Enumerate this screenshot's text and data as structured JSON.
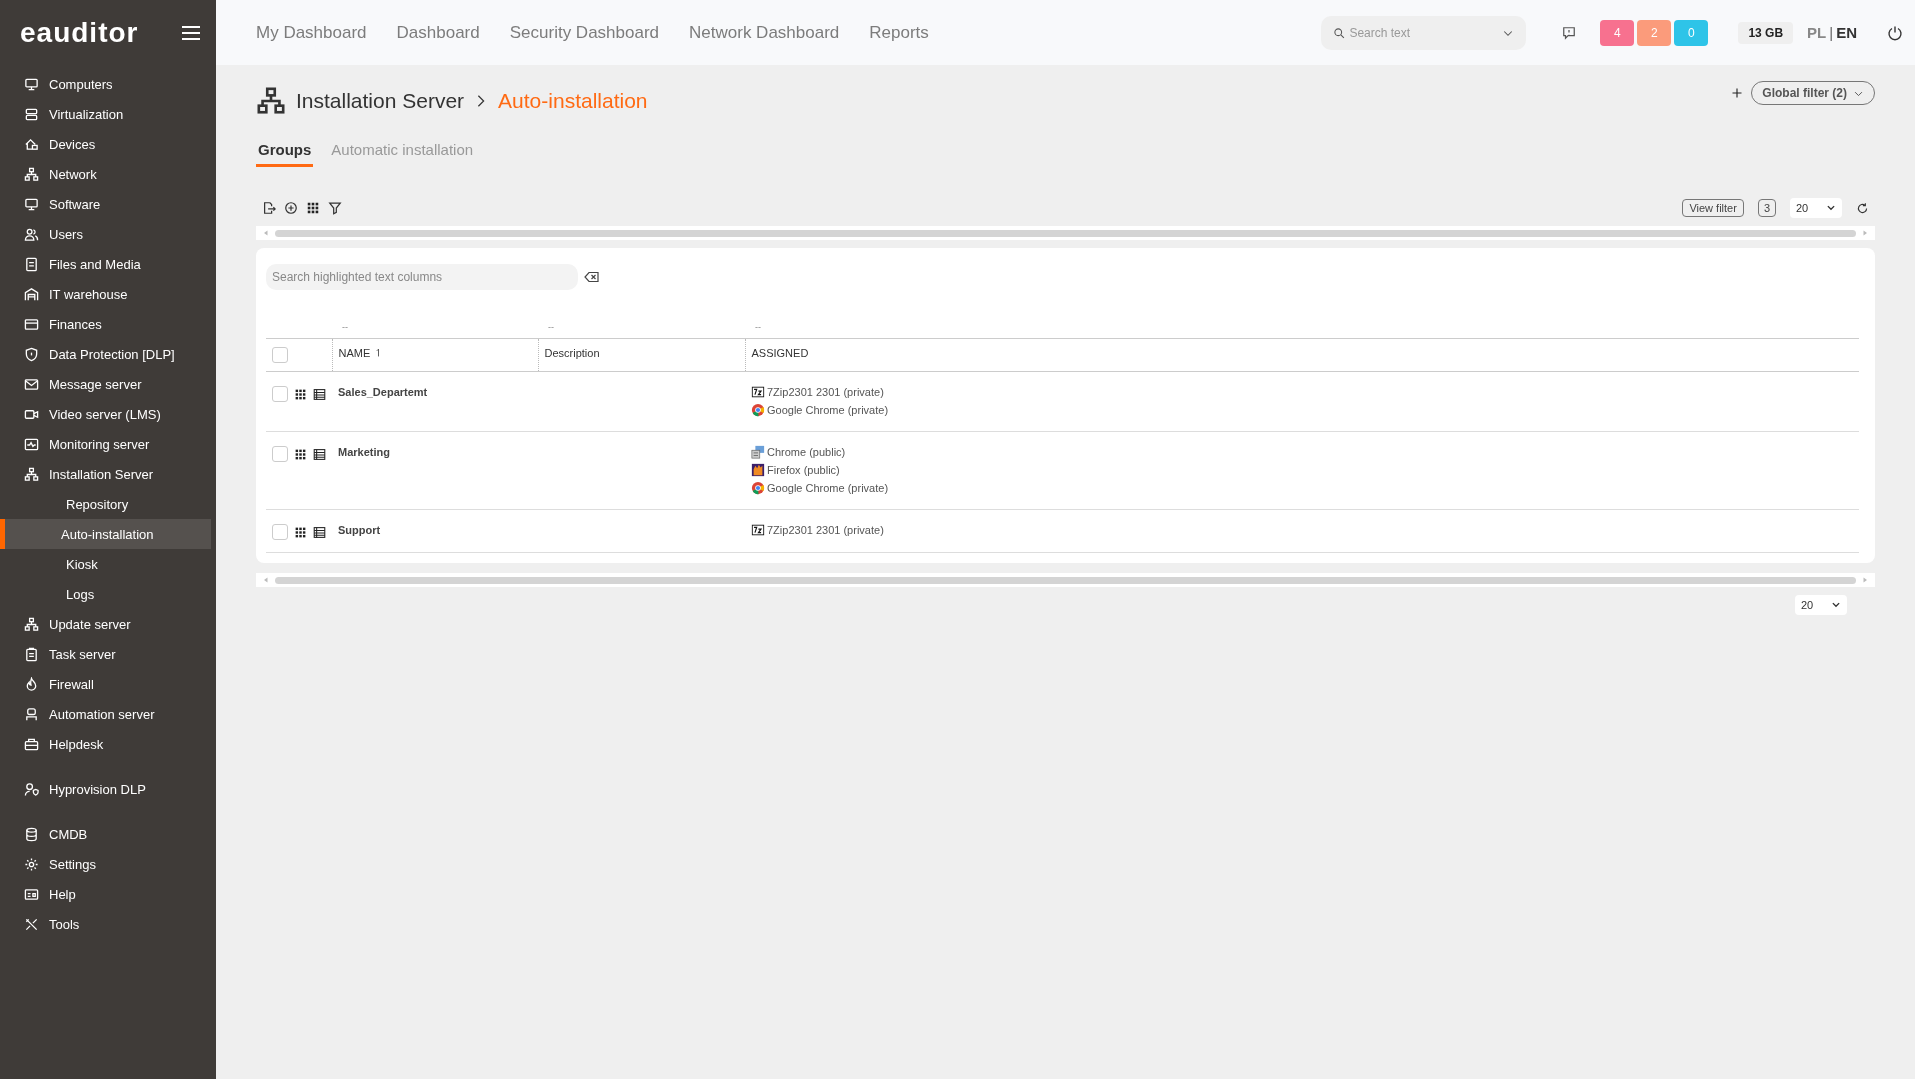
{
  "logo": "eauditor",
  "nav": [
    "My Dashboard",
    "Dashboard",
    "Security Dashboard",
    "Network Dashboard",
    "Reports"
  ],
  "search": {
    "placeholder": "Search text"
  },
  "alerts": [
    {
      "count": "4",
      "color": "#f7718f"
    },
    {
      "count": "2",
      "color": "#fb9b7b"
    },
    {
      "count": "0",
      "color": "#2ec4e8"
    }
  ],
  "disk": "13 GB",
  "languages": [
    {
      "label": "PL",
      "selected": false
    },
    {
      "label": "EN",
      "selected": true
    }
  ],
  "lang_separator": "|",
  "sidebar": {
    "groups": [
      [
        {
          "label": "Computers"
        },
        {
          "label": "Virtualization"
        },
        {
          "label": "Devices"
        },
        {
          "label": "Network"
        },
        {
          "label": "Software"
        },
        {
          "label": "Users"
        },
        {
          "label": "Files and Media"
        },
        {
          "label": "IT warehouse"
        },
        {
          "label": "Finances"
        },
        {
          "label": "Data Protection [DLP]"
        },
        {
          "label": "Message server"
        },
        {
          "label": "Video server (LMS)"
        },
        {
          "label": "Monitoring server"
        },
        {
          "label": "Installation Server",
          "children": [
            {
              "label": "Repository",
              "selected": false
            },
            {
              "label": "Auto-installation",
              "selected": true
            },
            {
              "label": "Kiosk",
              "selected": false
            },
            {
              "label": "Logs",
              "selected": false
            }
          ]
        },
        {
          "label": "Update server"
        },
        {
          "label": "Task server"
        },
        {
          "label": "Firewall"
        },
        {
          "label": "Automation server"
        },
        {
          "label": "Helpdesk"
        }
      ],
      [
        {
          "label": "Hyprovision DLP"
        }
      ],
      [
        {
          "label": "CMDB"
        },
        {
          "label": "Settings"
        },
        {
          "label": "Help"
        },
        {
          "label": "Tools"
        }
      ]
    ]
  },
  "breadcrumb": [
    "Installation Server",
    "Auto-installation"
  ],
  "global_filter": "Global filter (2)",
  "tabs": [
    {
      "label": "Groups",
      "selected": true
    },
    {
      "label": "Automatic installation",
      "selected": false
    }
  ],
  "toolbar": {
    "view_filter": "View filter",
    "count": "3",
    "page_size": "20"
  },
  "table": {
    "search_placeholder": "Search highlighted text columns",
    "column_filters": [
      "--",
      "--",
      "--"
    ],
    "columns": [
      {
        "label": "NAME",
        "sorted": true
      },
      {
        "label": "Description",
        "sorted": false
      },
      {
        "label": "ASSIGNED",
        "sorted": false
      }
    ],
    "select_all": {
      "checked": false
    },
    "rows": [
      {
        "checked": false,
        "name": "Sales_Departemt",
        "assigned": [
          {
            "kind": "sevenzip",
            "label": "7Zip2301 2301 (private)"
          },
          {
            "kind": "chrome",
            "label": "Google Chrome (private)"
          }
        ]
      },
      {
        "checked": false,
        "name": "Marketing",
        "assigned": [
          {
            "kind": "installer",
            "label": "Chrome (public)"
          },
          {
            "kind": "firefox",
            "label": "Firefox (public)"
          },
          {
            "kind": "chrome",
            "label": "Google Chrome (private)"
          }
        ]
      },
      {
        "checked": false,
        "name": "Support",
        "assigned": [
          {
            "kind": "sevenzip",
            "label": "7Zip2301 2301 (private)"
          }
        ]
      }
    ]
  },
  "footer": {
    "page_size": "20"
  }
}
